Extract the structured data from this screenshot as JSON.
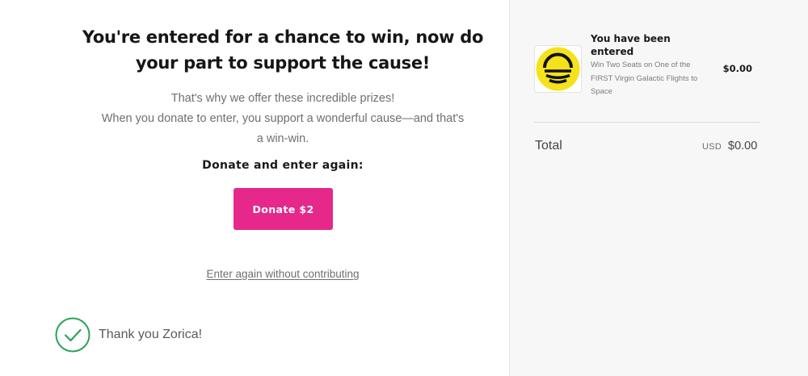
{
  "main": {
    "headline": "You're entered for a chance to win, now do your part to support the cause!",
    "body_line1": "That's why we offer these incredible prizes!",
    "body_line2": "When you donate to enter, you support a wonderful cause—and that's",
    "body_line3": "a win-win.",
    "donate_label": "Donate and enter again:",
    "donate_button": "Donate $2",
    "enter_again_link": "Enter again without contributing",
    "thanks_text": "Thank you Zorica!",
    "check_icon": "checkmark-circle-icon"
  },
  "order": {
    "product": {
      "title": "You have been entered",
      "description": "Win Two Seats on One of the FIRST Virgin Galactic Flights to Space",
      "price": "$0.00",
      "logo_icon": "yellow-circle-logo-icon"
    },
    "total_label": "Total",
    "currency": "USD",
    "total_value": "$0.00"
  },
  "colors": {
    "accent": "#e5288a",
    "success": "#2aa35a",
    "logo_yellow": "#f5e21c",
    "sidebar_bg": "#f7f7f7"
  }
}
